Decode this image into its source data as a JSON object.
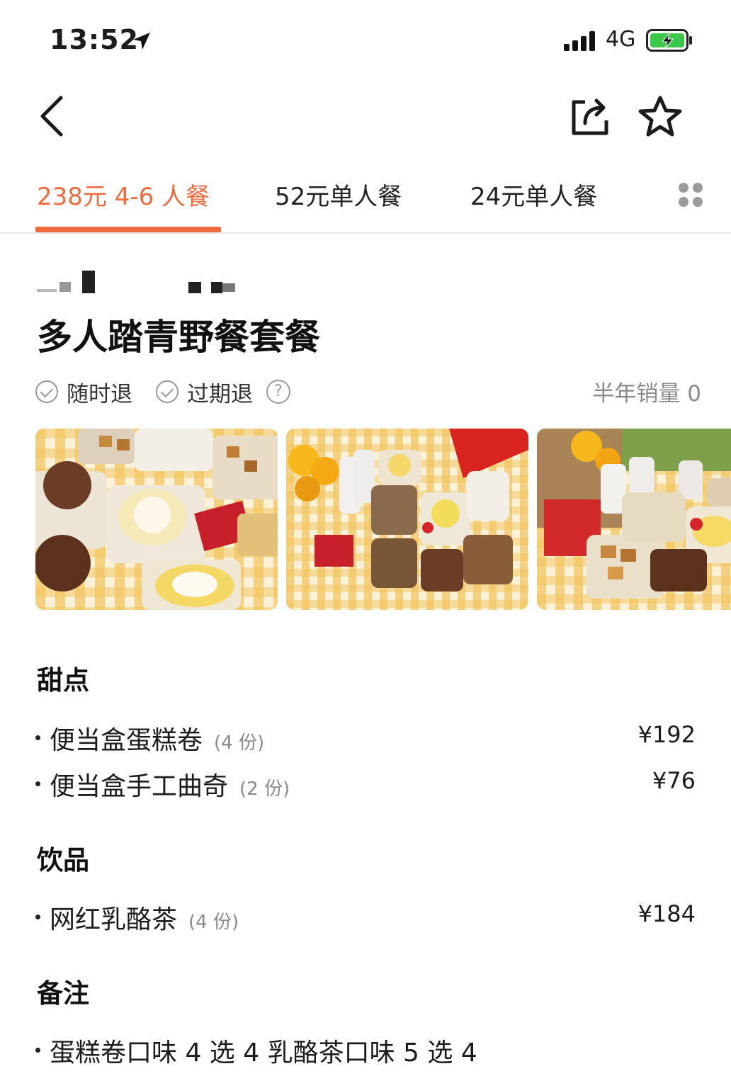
{
  "status_bar": {
    "time": "13:52",
    "network": "4G"
  },
  "tabs": [
    {
      "label": "238元 4-6 人餐"
    },
    {
      "label": "52元单人餐"
    },
    {
      "label": "24元单人餐"
    }
  ],
  "deal": {
    "title": "多人踏青野餐套餐",
    "tags": [
      {
        "label": "随时退"
      },
      {
        "label": "过期退"
      }
    ],
    "help_icon_text": "?",
    "sales": "半年销量 0"
  },
  "sections": [
    {
      "title": "甜点",
      "items": [
        {
          "name": "便当盒蛋糕卷",
          "qty": "(4 份)",
          "price": "¥192"
        },
        {
          "name": "便当盒手工曲奇",
          "qty": "(2 份)",
          "price": "¥76"
        }
      ]
    },
    {
      "title": "饮品",
      "items": [
        {
          "name": "网红乳酪茶",
          "qty": "(4 份)",
          "price": "¥184"
        }
      ]
    },
    {
      "title": "备注",
      "items": [
        {
          "name": "蛋糕卷口味 4 选 4 乳酪茶口味 5 选 4"
        }
      ]
    }
  ],
  "colors": {
    "accent": "#ef6a3c",
    "text": "#1c1c1c",
    "muted": "#8a8a8a",
    "divider": "#e6e6e6"
  },
  "icons": [
    "location-arrow-icon",
    "signal-icon",
    "battery-charging-icon",
    "back-chevron-icon",
    "share-icon",
    "star-icon",
    "grid-menu-icon",
    "check-circle-icon",
    "help-icon"
  ]
}
